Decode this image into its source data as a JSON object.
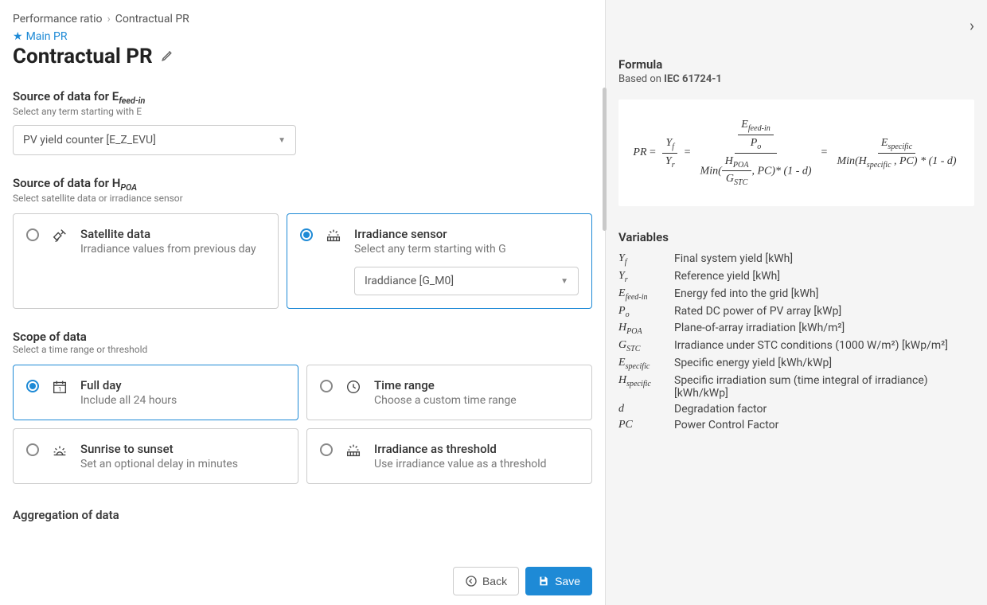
{
  "breadcrumb": {
    "lvl1": "Performance ratio",
    "lvl2": "Contractual PR"
  },
  "mainPr": {
    "label": "Main PR"
  },
  "title": "Contractual PR",
  "efeedin": {
    "label_prefix": "Source of data for E",
    "label_sub": "feed-in",
    "hint": "Select any term starting with E",
    "value": "PV yield counter [E_Z_EVU]"
  },
  "hpoa": {
    "label_prefix": "Source of data for H",
    "label_sub": "POA",
    "hint": "Select satellite data or irradiance sensor",
    "options": {
      "satellite": {
        "title": "Satellite data",
        "sub": "Irradiance values from previous day"
      },
      "sensor": {
        "title": "Irradiance sensor",
        "sub": "Select any term starting with G",
        "value": "Iraddiance [G_M0]"
      }
    }
  },
  "scope": {
    "label": "Scope of data",
    "hint": "Select a time range or threshold",
    "options": {
      "fullday": {
        "title": "Full day",
        "sub": "Include all 24 hours"
      },
      "timerange": {
        "title": "Time range",
        "sub": "Choose a custom time range"
      },
      "sunrise": {
        "title": "Sunrise to sunset",
        "sub": "Set an optional delay in minutes"
      },
      "threshold": {
        "title": "Irradiance as threshold",
        "sub": "Use irradiance value as a threshold"
      }
    }
  },
  "aggregation": {
    "label": "Aggregation of data"
  },
  "footer": {
    "back": "Back",
    "save": "Save"
  },
  "side": {
    "formula_title": "Formula",
    "based_on_prefix": "Based on ",
    "based_on_bold": "IEC 61724-1",
    "variables_title": "Variables",
    "vars": [
      {
        "sym_html": "Y<sub>f</sub>",
        "desc": "Final system yield [kWh]"
      },
      {
        "sym_html": "Y<sub>r</sub>",
        "desc": "Reference yield [kWh]"
      },
      {
        "sym_html": "E<sub>feed-in</sub>",
        "desc": "Energy fed into the grid [kWh]"
      },
      {
        "sym_html": "P<sub>o</sub>",
        "desc": "Rated DC power of PV array [kWp]"
      },
      {
        "sym_html": "H<sub>POA</sub>",
        "desc": "Plane-of-array irradiation [kWh/m²]"
      },
      {
        "sym_html": "G<sub>STC</sub>",
        "desc": "Irradiance under STC conditions (1000 W/m²) [kWp/m²]"
      },
      {
        "sym_html": "E<sub>specific</sub>",
        "desc": "Specific energy yield [kWh/kWp]"
      },
      {
        "sym_html": "H<sub>specific</sub>",
        "desc": "Specific irradiation sum (time integral of irradiance) [kWh/kWp]"
      },
      {
        "sym_html": "d",
        "desc": "Degradation factor"
      },
      {
        "sym_html": "PC",
        "desc": "Power Control Factor"
      }
    ]
  }
}
